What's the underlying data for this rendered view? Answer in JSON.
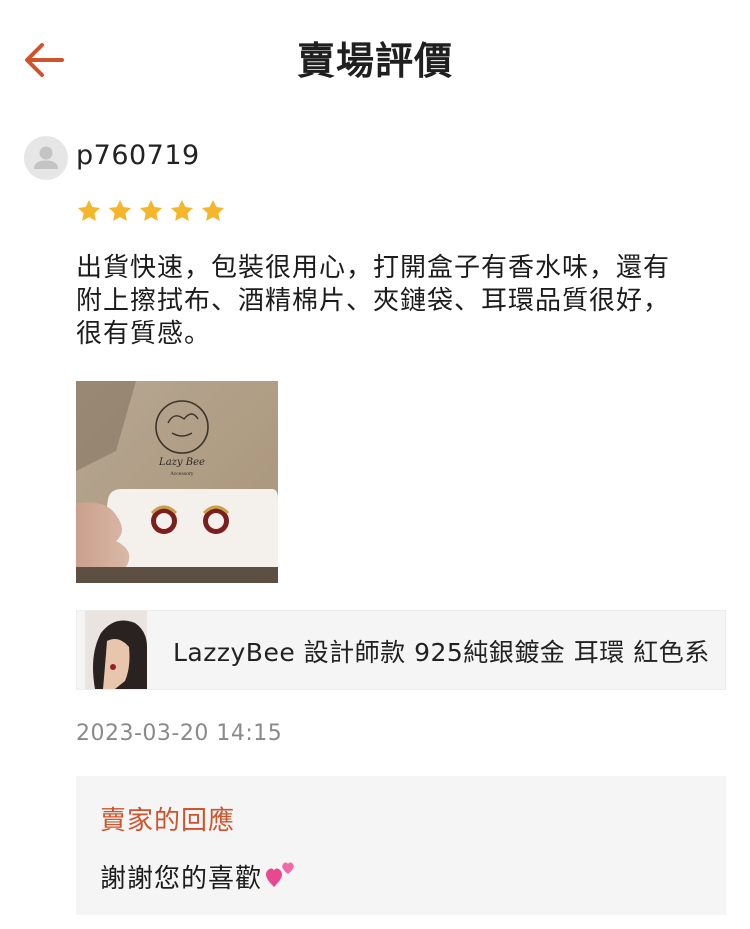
{
  "header": {
    "title": "賣場評價",
    "back_icon": "arrow-left-icon",
    "accent_color": "#d0532b"
  },
  "review": {
    "username": "p760719",
    "avatar_icon": "default-user-icon",
    "rating": 5,
    "rating_max": 5,
    "star_color": "#f6b62b",
    "text": "出貨快速，包裝很用心，打開盒子有香水味，還有\n附上擦拭布、酒精棉片、夾鏈袋、耳環品質很好，\n很有質感。",
    "photo": {
      "logo_text": "Lazy Bee",
      "logo_subtext": "Accessory"
    },
    "product": {
      "name": "LazzyBee 設計師款 925純銀鍍金 耳環 紅色系"
    },
    "timestamp": "2023-03-20 14:15",
    "seller_reply": {
      "title": "賣家的回應",
      "text": "謝謝您的喜歡",
      "emoji_icon": "two-hearts-icon"
    }
  }
}
